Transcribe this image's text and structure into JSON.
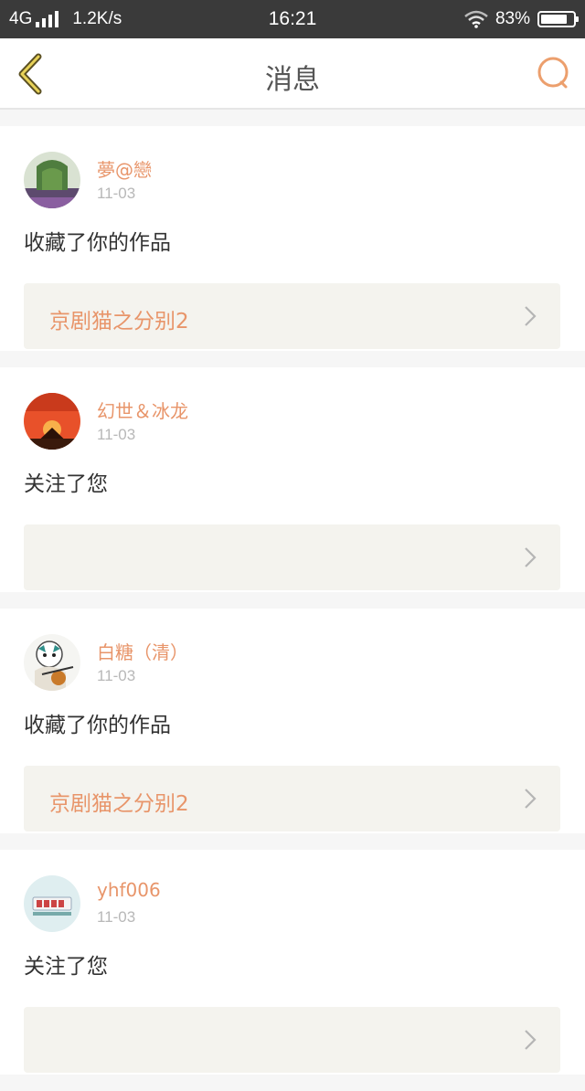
{
  "status_bar": {
    "network": "4G",
    "speed": "1.2K/s",
    "time": "16:21",
    "battery": "83%",
    "battery_level": 0.83
  },
  "nav": {
    "back_icon": "chevron-left-icon",
    "title": "消息",
    "search_icon": "search-icon",
    "accent_color": "#e8956a"
  },
  "messages": [
    {
      "user": "夢@戀",
      "date": "11-03",
      "action": "收藏了你的作品",
      "work": "京剧猫之分别2"
    },
    {
      "user": "幻世＆冰龙",
      "date": "11-03",
      "action": "关注了您",
      "work": ""
    },
    {
      "user": "白糖（清）",
      "date": "11-03",
      "action": "收藏了你的作品",
      "work": "京剧猫之分别2"
    },
    {
      "user": "yhf006",
      "date": "11-03",
      "action": "关注了您",
      "work": ""
    }
  ]
}
